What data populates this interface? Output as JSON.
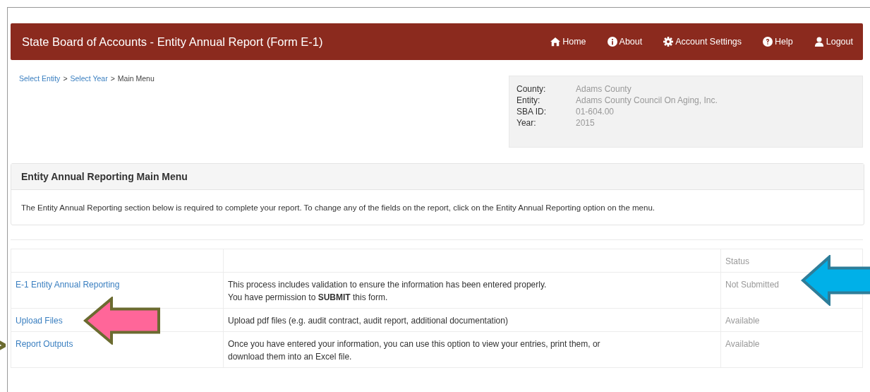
{
  "header": {
    "title": "State Board of Accounts - Entity Annual Report (Form E-1)",
    "nav": [
      "Home",
      "About",
      "Account Settings",
      "Help",
      "Logout"
    ]
  },
  "breadcrumb": [
    {
      "kind": "link",
      "label": "Select Entity"
    },
    {
      "kind": "separator",
      "label": ">"
    },
    {
      "kind": "link",
      "label": "Select Year"
    },
    {
      "kind": "separator",
      "label": ">"
    },
    {
      "kind": "current",
      "label": "Main Menu"
    }
  ],
  "info": [
    {
      "label": "County:",
      "value": "Adams County"
    },
    {
      "label": "Entity:",
      "value": "Adams County Council On Aging, Inc."
    },
    {
      "label": "SBA ID:",
      "value": "01-604.00"
    },
    {
      "label": "Year:",
      "value": "2015"
    }
  ],
  "panel": {
    "title": "Entity Annual Reporting Main Menu",
    "text": "The Entity Annual Reporting section below is required to complete your report. To change any of the fields on the report, click on the Entity Annual Reporting option on the menu."
  },
  "table": {
    "columns": [
      "Status"
    ],
    "rows": [
      {
        "option": "E-1 Entity Annual Reporting",
        "description": [
          "This process includes validation to ensure the information has been entered properly.",
          "You have permission to **SUBMIT** this form."
        ],
        "status": "Not Submitted"
      },
      {
        "option": "Upload Files",
        "description": [
          "Upload pdf files (e.g. audit contract, audit report, additional documentation)"
        ],
        "status": "Available"
      },
      {
        "option": "Report Outputs",
        "description": [
          "Once you have entered your information, you can use this option to view your entries, print them, or",
          "download them into an Excel file."
        ],
        "status": "Available"
      }
    ]
  },
  "annotations": [
    {
      "kind": "arrow",
      "color": "#ff6699"
    },
    {
      "kind": "arrow",
      "color": "#00b0e8"
    },
    {
      "kind": "arrow-tip",
      "color": "#6b6b30"
    }
  ]
}
